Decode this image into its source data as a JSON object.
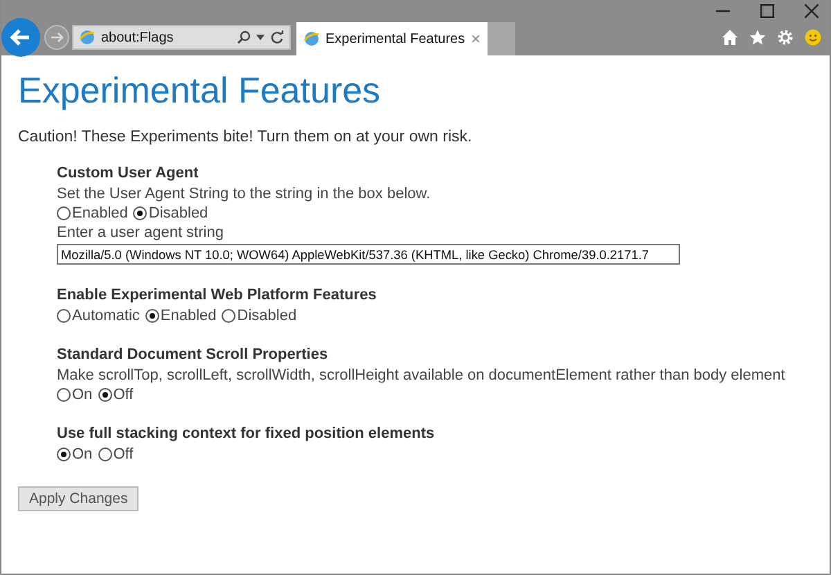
{
  "browser": {
    "address": "about:Flags",
    "tab_title": "Experimental Features",
    "tab_close": "×"
  },
  "page": {
    "title": "Experimental Features",
    "caution": "Caution! These Experiments bite! Turn them on at your own risk.",
    "features": [
      {
        "title": "Custom User Agent",
        "description": "Set the User Agent String to the string in the box below.",
        "options": [
          {
            "label": "Enabled",
            "selected": false
          },
          {
            "label": "Disabled",
            "selected": true
          }
        ],
        "input": {
          "label": "Enter a user agent string",
          "value": "Mozilla/5.0 (Windows NT 10.0; WOW64) AppleWebKit/537.36 (KHTML, like Gecko) Chrome/39.0.2171.7"
        }
      },
      {
        "title": "Enable Experimental Web Platform Features",
        "options": [
          {
            "label": "Automatic",
            "selected": false
          },
          {
            "label": "Enabled",
            "selected": true
          },
          {
            "label": "Disabled",
            "selected": false
          }
        ]
      },
      {
        "title": "Standard Document Scroll Properties",
        "description": "Make scrollTop, scrollLeft, scrollWidth, scrollHeight available on documentElement rather than body element",
        "options": [
          {
            "label": "On",
            "selected": false
          },
          {
            "label": "Off",
            "selected": true
          }
        ]
      },
      {
        "title": "Use full stacking context for fixed position elements",
        "options": [
          {
            "label": "On",
            "selected": true
          },
          {
            "label": "Off",
            "selected": false
          }
        ]
      }
    ],
    "apply_button": "Apply Changes"
  }
}
